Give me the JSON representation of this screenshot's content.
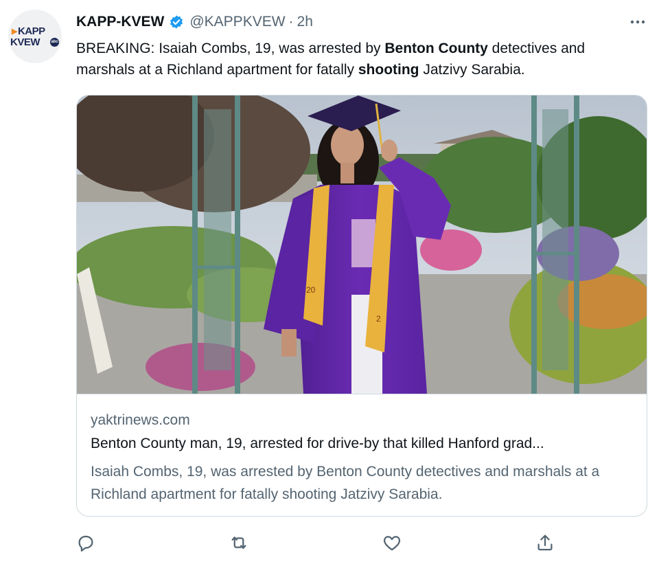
{
  "tweet": {
    "display_name": "KAPP-KVEW",
    "handle": "@KAPPKVEW",
    "separator": "·",
    "time": "2h",
    "text_parts": [
      {
        "text": "BREAKING: Isaiah Combs, 19, was arrested by ",
        "bold": false
      },
      {
        "text": "Benton County",
        "bold": true
      },
      {
        "text": " detectives and marshals at a Richland apartment for fatally ",
        "bold": false
      },
      {
        "text": "shooting",
        "bold": true
      },
      {
        "text": " Jatzivy Sarabia.",
        "bold": false
      }
    ]
  },
  "avatar": {
    "logo_line1": "KAPP",
    "logo_line2": "KVEW",
    "logo_badge": "abc"
  },
  "card": {
    "domain": "yaktrinews.com",
    "title": "Benton County man, 19, arrested for drive-by that killed Hanford grad...",
    "description": "Isaiah Combs, 19, was arrested by Benton County detectives and marshals at a Richland apartment for fatally shooting Jatzivy Sarabia.",
    "photo_text_1": "20",
    "photo_text_2": "2"
  },
  "icons": {
    "verified": "verified-badge-icon",
    "more": "more-options-icon",
    "reply": "reply-icon",
    "retweet": "retweet-icon",
    "like": "like-icon",
    "share": "share-icon"
  },
  "colors": {
    "verified": "#1d9bf0",
    "text": "#0f1419",
    "secondary": "#536471",
    "border": "#cfd9de",
    "gown": "#6a2bb3",
    "stole": "#e9b23c"
  }
}
